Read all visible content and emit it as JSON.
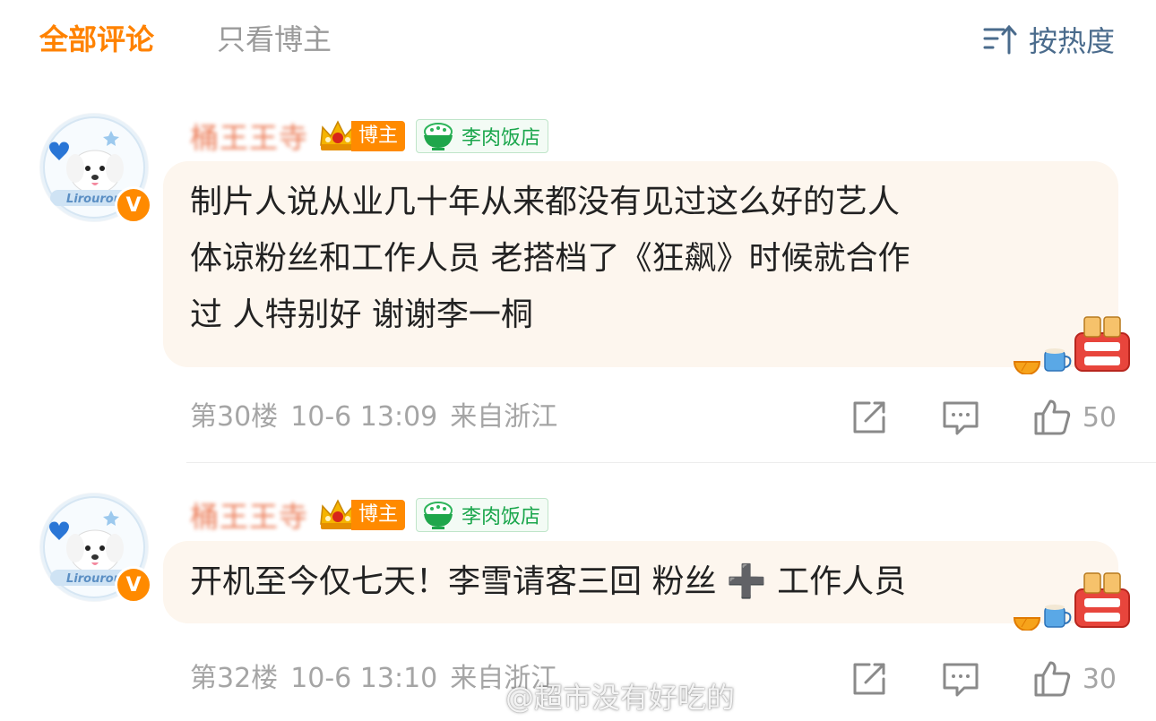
{
  "tabs": {
    "all": "全部评论",
    "blogger_only": "只看博主"
  },
  "sort": {
    "label": "按热度",
    "icon": "sort-icon"
  },
  "comments": [
    {
      "user_name": "桶王王寺",
      "avatar_text": "Lirourou",
      "verified_mark": "V",
      "badges": {
        "blogger": "博主",
        "shop": "李肉饭店"
      },
      "text_lines": [
        "制片人说从业几十年从来都没有见过这么好的艺人",
        "体谅粉丝和工作人员 老搭档了《狂飙》时候就合作",
        "过 人特别好 谢谢李一桐"
      ],
      "floor": "第30楼",
      "time": "10-6 13:09",
      "location": "来自浙江",
      "likes": "50"
    },
    {
      "user_name": "桶王王寺",
      "avatar_text": "Lirourou",
      "verified_mark": "V",
      "badges": {
        "blogger": "博主",
        "shop": "李肉饭店"
      },
      "text_lines": [
        "开机至今仅七天！李雪请客三回 粉丝 ➕ 工作人员"
      ],
      "floor": "第32楼",
      "time": "10-6 13:10",
      "location": "来自浙江",
      "likes": "30"
    }
  ],
  "watermark": "@超市没有好吃的",
  "colors": {
    "accent": "#ff8200",
    "sort_blue": "#4a6b8c",
    "bubble_bg": "#fdf6ee",
    "shop_green": "#1aa64c",
    "meta_gray": "#a5a5a5"
  }
}
